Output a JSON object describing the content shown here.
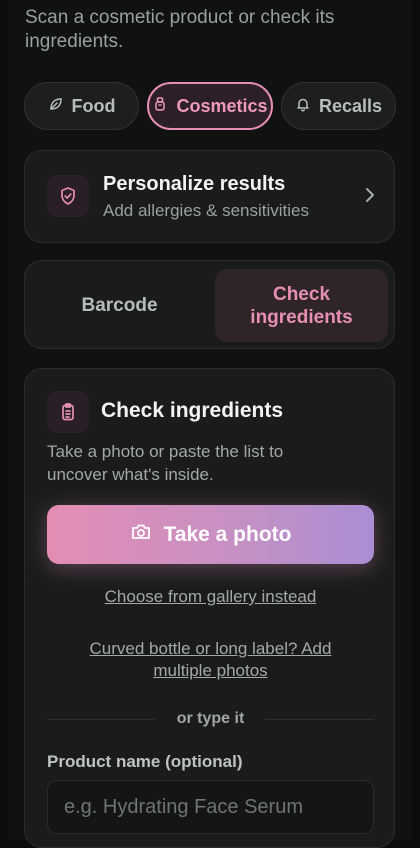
{
  "header": {
    "subtitle": "Scan a cosmetic product or check its ingredients."
  },
  "category_tabs": [
    {
      "label": "Food",
      "icon": "leaf-icon",
      "selected": false
    },
    {
      "label": "Cosmetics",
      "icon": "bottle-icon",
      "selected": true
    },
    {
      "label": "Recalls",
      "icon": "bell-icon",
      "selected": false
    }
  ],
  "personalize": {
    "title": "Personalize results",
    "subtitle": "Add allergies & sensitivities",
    "icon": "shield-check-icon"
  },
  "mode_tabs": [
    {
      "label": "Barcode",
      "selected": false
    },
    {
      "label": "Check ingredients",
      "selected": true
    }
  ],
  "check_ingredients": {
    "title": "Check ingredients",
    "description": "Take a photo or paste the list to uncover what's inside.",
    "photo_button": "Take a photo",
    "gallery_link": "Choose from gallery instead",
    "multi_photo_link": "Curved bottle or long label? Add multiple photos",
    "divider_text": "or type it",
    "product_name_label": "Product name (optional)",
    "product_name_placeholder": "e.g. Hydrating Face Serum",
    "product_name_value": ""
  },
  "colors": {
    "accent": "#e58fb5",
    "gradient_start": "#e48db4",
    "gradient_end": "#aa8ed3",
    "background": "#101211"
  }
}
